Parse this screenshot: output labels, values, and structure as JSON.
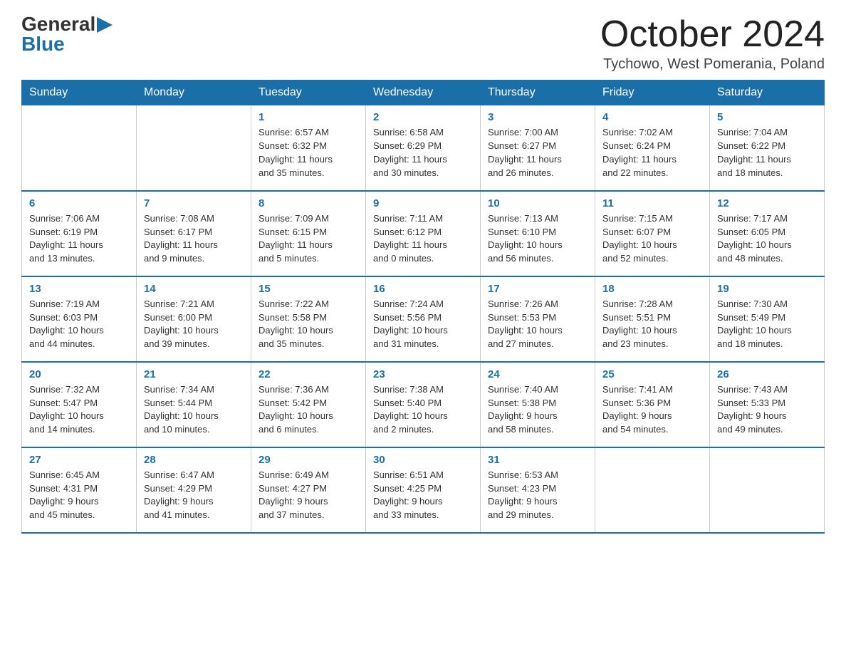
{
  "header": {
    "logo_general": "General",
    "logo_blue": "Blue",
    "month_title": "October 2024",
    "location": "Tychowo, West Pomerania, Poland"
  },
  "days_of_week": [
    "Sunday",
    "Monday",
    "Tuesday",
    "Wednesday",
    "Thursday",
    "Friday",
    "Saturday"
  ],
  "weeks": [
    [
      {
        "day": "",
        "info": ""
      },
      {
        "day": "",
        "info": ""
      },
      {
        "day": "1",
        "info": "Sunrise: 6:57 AM\nSunset: 6:32 PM\nDaylight: 11 hours\nand 35 minutes."
      },
      {
        "day": "2",
        "info": "Sunrise: 6:58 AM\nSunset: 6:29 PM\nDaylight: 11 hours\nand 30 minutes."
      },
      {
        "day": "3",
        "info": "Sunrise: 7:00 AM\nSunset: 6:27 PM\nDaylight: 11 hours\nand 26 minutes."
      },
      {
        "day": "4",
        "info": "Sunrise: 7:02 AM\nSunset: 6:24 PM\nDaylight: 11 hours\nand 22 minutes."
      },
      {
        "day": "5",
        "info": "Sunrise: 7:04 AM\nSunset: 6:22 PM\nDaylight: 11 hours\nand 18 minutes."
      }
    ],
    [
      {
        "day": "6",
        "info": "Sunrise: 7:06 AM\nSunset: 6:19 PM\nDaylight: 11 hours\nand 13 minutes."
      },
      {
        "day": "7",
        "info": "Sunrise: 7:08 AM\nSunset: 6:17 PM\nDaylight: 11 hours\nand 9 minutes."
      },
      {
        "day": "8",
        "info": "Sunrise: 7:09 AM\nSunset: 6:15 PM\nDaylight: 11 hours\nand 5 minutes."
      },
      {
        "day": "9",
        "info": "Sunrise: 7:11 AM\nSunset: 6:12 PM\nDaylight: 11 hours\nand 0 minutes."
      },
      {
        "day": "10",
        "info": "Sunrise: 7:13 AM\nSunset: 6:10 PM\nDaylight: 10 hours\nand 56 minutes."
      },
      {
        "day": "11",
        "info": "Sunrise: 7:15 AM\nSunset: 6:07 PM\nDaylight: 10 hours\nand 52 minutes."
      },
      {
        "day": "12",
        "info": "Sunrise: 7:17 AM\nSunset: 6:05 PM\nDaylight: 10 hours\nand 48 minutes."
      }
    ],
    [
      {
        "day": "13",
        "info": "Sunrise: 7:19 AM\nSunset: 6:03 PM\nDaylight: 10 hours\nand 44 minutes."
      },
      {
        "day": "14",
        "info": "Sunrise: 7:21 AM\nSunset: 6:00 PM\nDaylight: 10 hours\nand 39 minutes."
      },
      {
        "day": "15",
        "info": "Sunrise: 7:22 AM\nSunset: 5:58 PM\nDaylight: 10 hours\nand 35 minutes."
      },
      {
        "day": "16",
        "info": "Sunrise: 7:24 AM\nSunset: 5:56 PM\nDaylight: 10 hours\nand 31 minutes."
      },
      {
        "day": "17",
        "info": "Sunrise: 7:26 AM\nSunset: 5:53 PM\nDaylight: 10 hours\nand 27 minutes."
      },
      {
        "day": "18",
        "info": "Sunrise: 7:28 AM\nSunset: 5:51 PM\nDaylight: 10 hours\nand 23 minutes."
      },
      {
        "day": "19",
        "info": "Sunrise: 7:30 AM\nSunset: 5:49 PM\nDaylight: 10 hours\nand 18 minutes."
      }
    ],
    [
      {
        "day": "20",
        "info": "Sunrise: 7:32 AM\nSunset: 5:47 PM\nDaylight: 10 hours\nand 14 minutes."
      },
      {
        "day": "21",
        "info": "Sunrise: 7:34 AM\nSunset: 5:44 PM\nDaylight: 10 hours\nand 10 minutes."
      },
      {
        "day": "22",
        "info": "Sunrise: 7:36 AM\nSunset: 5:42 PM\nDaylight: 10 hours\nand 6 minutes."
      },
      {
        "day": "23",
        "info": "Sunrise: 7:38 AM\nSunset: 5:40 PM\nDaylight: 10 hours\nand 2 minutes."
      },
      {
        "day": "24",
        "info": "Sunrise: 7:40 AM\nSunset: 5:38 PM\nDaylight: 9 hours\nand 58 minutes."
      },
      {
        "day": "25",
        "info": "Sunrise: 7:41 AM\nSunset: 5:36 PM\nDaylight: 9 hours\nand 54 minutes."
      },
      {
        "day": "26",
        "info": "Sunrise: 7:43 AM\nSunset: 5:33 PM\nDaylight: 9 hours\nand 49 minutes."
      }
    ],
    [
      {
        "day": "27",
        "info": "Sunrise: 6:45 AM\nSunset: 4:31 PM\nDaylight: 9 hours\nand 45 minutes."
      },
      {
        "day": "28",
        "info": "Sunrise: 6:47 AM\nSunset: 4:29 PM\nDaylight: 9 hours\nand 41 minutes."
      },
      {
        "day": "29",
        "info": "Sunrise: 6:49 AM\nSunset: 4:27 PM\nDaylight: 9 hours\nand 37 minutes."
      },
      {
        "day": "30",
        "info": "Sunrise: 6:51 AM\nSunset: 4:25 PM\nDaylight: 9 hours\nand 33 minutes."
      },
      {
        "day": "31",
        "info": "Sunrise: 6:53 AM\nSunset: 4:23 PM\nDaylight: 9 hours\nand 29 minutes."
      },
      {
        "day": "",
        "info": ""
      },
      {
        "day": "",
        "info": ""
      }
    ]
  ]
}
